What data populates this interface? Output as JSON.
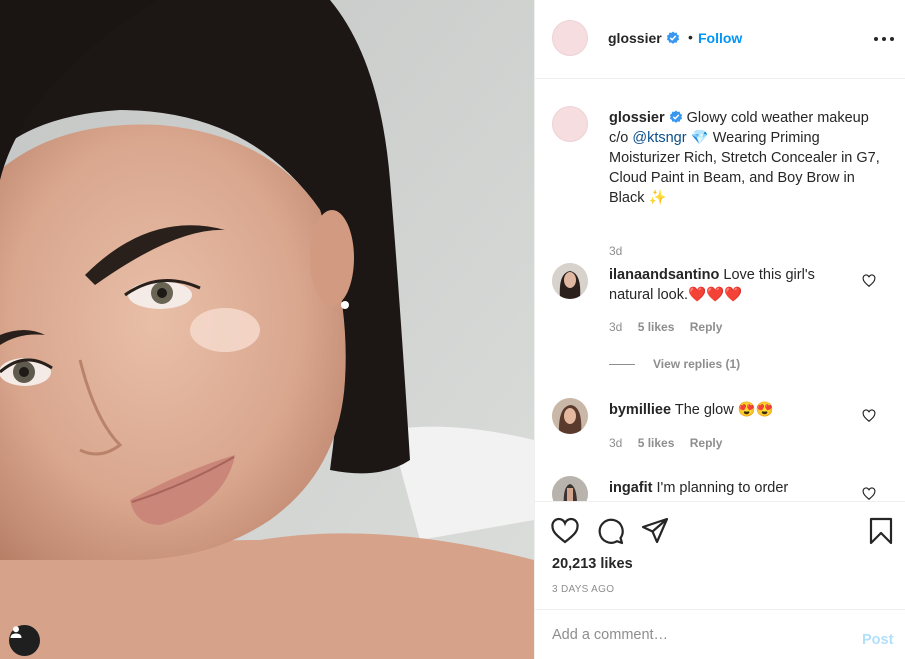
{
  "post": {
    "username": "glossier",
    "dot": "•",
    "follow_label": "Follow",
    "caption_text": "Glowy cold weather makeup c/o",
    "caption_mention": "@ktsngr",
    "caption_emoji_1": "💎",
    "caption_text_2": "Wearing Priming Moisturizer Rich, Stretch Concealer in G7, Cloud Paint in Beam, and Boy Brow in Black",
    "caption_emoji_2": "✨",
    "caption_time": "3d",
    "likes": "20,213 likes",
    "time_ago": "3 DAYS AGO"
  },
  "comments": [
    {
      "username": "ilanaandsantino",
      "text": "Love this girl's natural look.",
      "emoji": "❤️❤️❤️",
      "time": "3d",
      "likes": "5 likes",
      "reply": "Reply",
      "view_replies": "View replies (1)"
    },
    {
      "username": "bymilliee",
      "text": "The glow",
      "emoji": "😍😍",
      "time": "3d",
      "likes": "5 likes",
      "reply": "Reply"
    },
    {
      "username": "ingafit",
      "text": "I'm planning to order"
    }
  ],
  "add_comment": {
    "placeholder": "Add a comment…",
    "post_label": "Post"
  },
  "icons": {
    "more": "more-options-icon",
    "verified": "verified-badge-icon",
    "like": "heart-icon",
    "comment": "comment-icon",
    "share": "share-icon",
    "save": "bookmark-icon",
    "user_tag": "user-tag-icon"
  },
  "colors": {
    "accent": "#0095f6",
    "verified": "#3897f0",
    "muted": "#8e8e8e",
    "post_disabled": "#b2dffc"
  }
}
